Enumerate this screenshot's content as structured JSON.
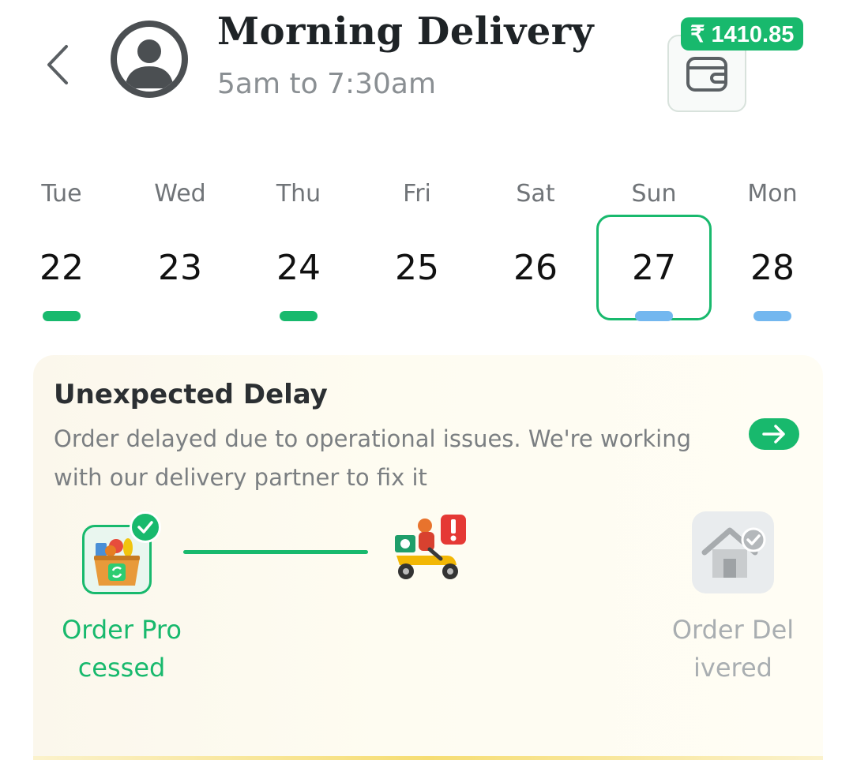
{
  "header": {
    "title": "Morning Delivery",
    "subtitle": "5am to 7:30am",
    "back_icon": "chevron-left-icon",
    "avatar_icon": "user-avatar-icon"
  },
  "wallet": {
    "balance": "₹ 1410.85",
    "icon": "wallet-icon",
    "badge_color": "#18b96d"
  },
  "calendar": {
    "days": [
      {
        "name": "Tue",
        "date": "22",
        "marker": "green"
      },
      {
        "name": "Wed",
        "date": "23",
        "marker": "none"
      },
      {
        "name": "Thu",
        "date": "24",
        "marker": "green"
      },
      {
        "name": "Fri",
        "date": "25",
        "marker": "none"
      },
      {
        "name": "Sat",
        "date": "26",
        "marker": "none"
      },
      {
        "name": "Sun",
        "date": "27",
        "marker": "blue",
        "selected": true
      },
      {
        "name": "Mon",
        "date": "28",
        "marker": "blue"
      }
    ],
    "accent_color": "#18b96d",
    "scheduled_color": "#73b7ef"
  },
  "delay_card": {
    "title": "Unexpected Delay",
    "description": "Order delayed due to operational issues. We're working with our delivery partner to fix it",
    "arrow_icon": "arrow-right-icon"
  },
  "tracker": {
    "steps": [
      {
        "label": "Order Processed",
        "status": "done",
        "icon": "grocery-basket-icon"
      },
      {
        "label": "",
        "status": "alert",
        "icon": "delivery-scooter-alert-icon"
      },
      {
        "label": "Order Delivered",
        "status": "pending",
        "icon": "house-check-icon"
      }
    ]
  }
}
